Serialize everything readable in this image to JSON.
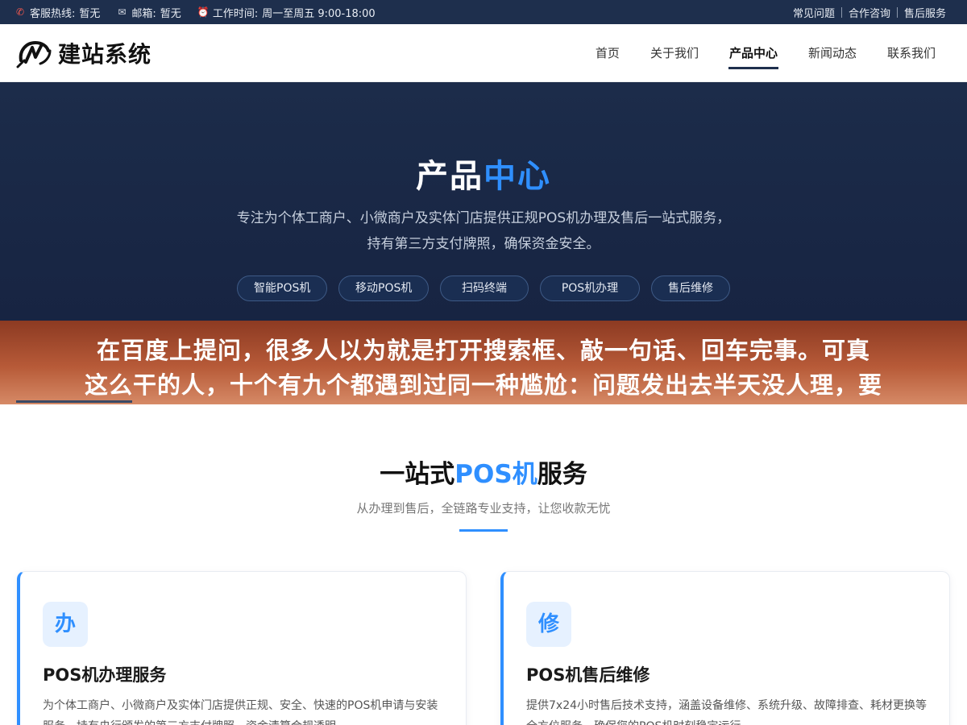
{
  "topbar": {
    "hotline_label": "客服热线:",
    "hotline_value": "暂无",
    "email_label": "邮箱:",
    "email_value": "暂无",
    "hours_label": "工作时间:",
    "hours_value": "周一至周五 9:00-18:00",
    "links": [
      "常见问题",
      "合作咨询",
      "售后服务"
    ]
  },
  "header": {
    "logo_text": "建站系统",
    "nav": [
      "首页",
      "关于我们",
      "产品中心",
      "新闻动态",
      "联系我们"
    ],
    "active_nav": "产品中心"
  },
  "hero": {
    "title_a": "产品",
    "title_b": "中心",
    "desc": "专注为个体工商户、小微商户及实体门店提供正规POS机办理及售后一站式服务，持有第三方支付牌照，确保资金安全。",
    "pills": [
      "智能POS机",
      "移动POS机",
      "扫码终端",
      "POS机办理",
      "售后维修"
    ]
  },
  "banner": {
    "line1": "在百度上提问，很多人以为就是打开搜索框、敲一句话、回车完事。可真",
    "line2": "这么干的人，十个有九个都遇到过同一种尴尬：问题发出去半天没人理，要"
  },
  "section": {
    "title_a": "一站式",
    "title_b": "POS机",
    "title_c": "服务",
    "subtitle": "从办理到售后，全链路专业支持，让您收款无忧"
  },
  "cards": [
    {
      "badge": "办",
      "title": "POS机办理服务",
      "desc": "为个体工商户、小微商户及实体门店提供正规、安全、快速的POS机申请与安装服务，持有央行颁发的第三方支付牌照，资金清算合规透明。"
    },
    {
      "badge": "修",
      "title": "POS机售后维修",
      "desc": "提供7x24小时售后技术支持，涵盖设备维修、系统升级、故障排查、耗材更换等全方位服务，确保您的POS机时刻稳定运行。"
    }
  ]
}
